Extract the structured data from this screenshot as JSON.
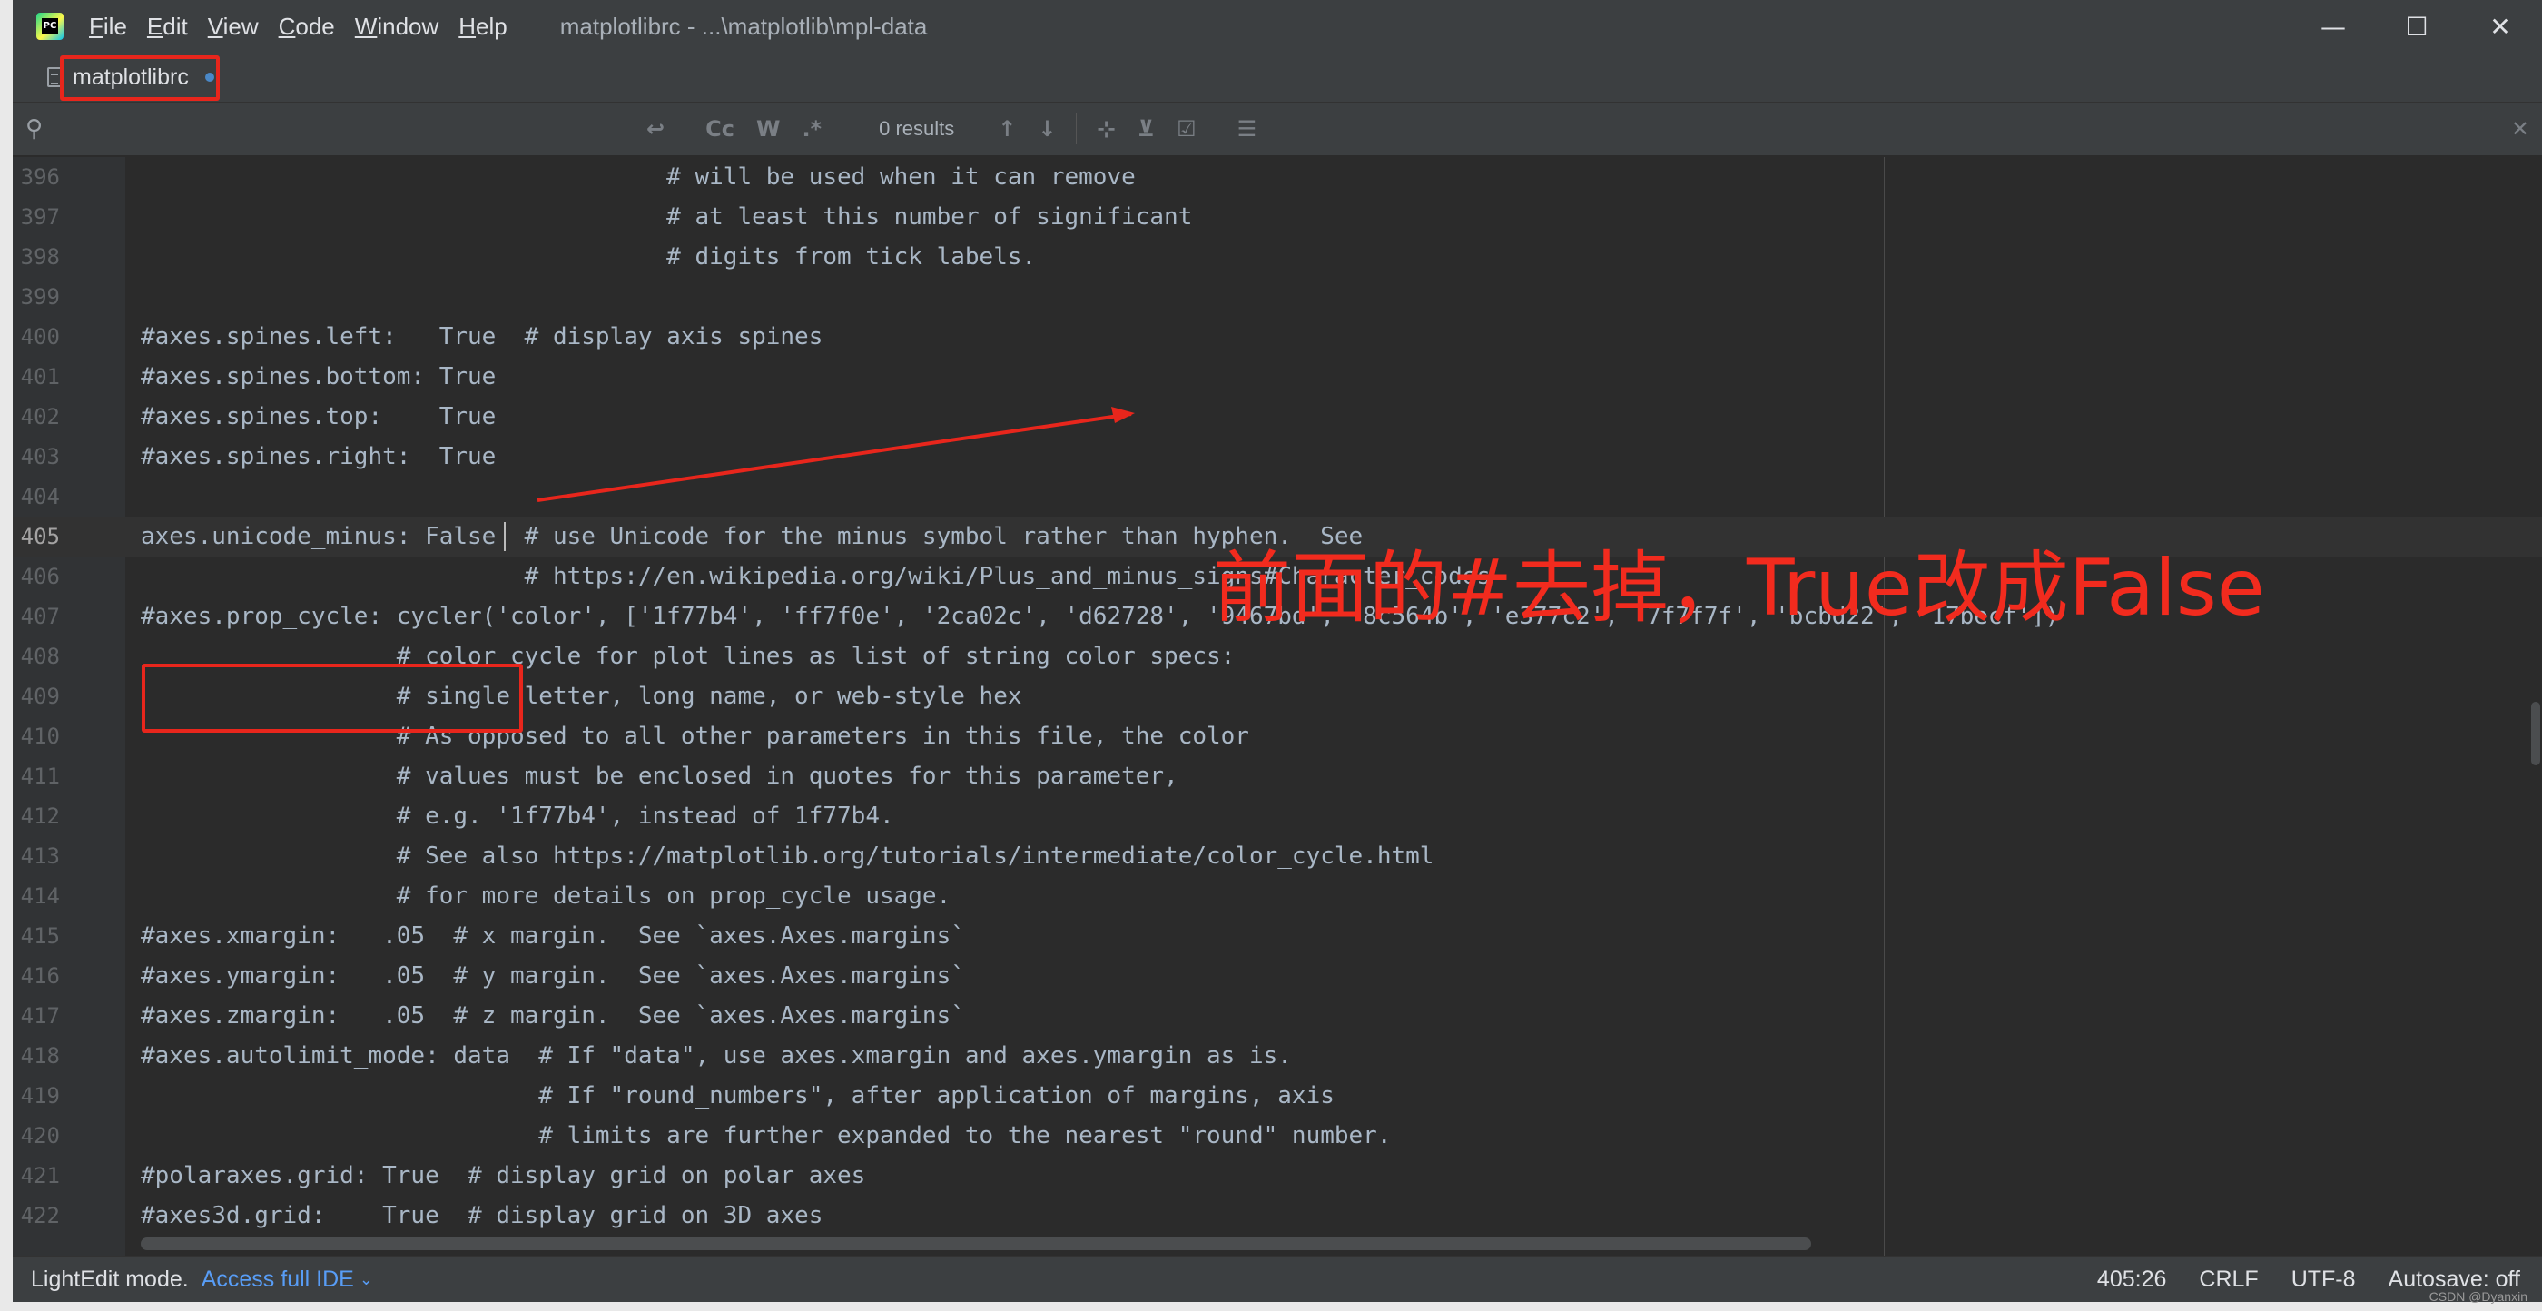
{
  "titlebar": {
    "app_icon": "pycharm-logo-icon",
    "app_icon_text": "PC",
    "menu": [
      {
        "first": "F",
        "rest": "ile"
      },
      {
        "first": "E",
        "rest": "dit"
      },
      {
        "first": "V",
        "rest": "iew"
      },
      {
        "first": "C",
        "rest": "ode"
      },
      {
        "first": "W",
        "rest": "indow"
      },
      {
        "first": "H",
        "rest": "elp"
      }
    ],
    "title": "matplotlibrc - ...\\matplotlib\\mpl-data",
    "controls": {
      "minimize": "—",
      "maximize": "☐",
      "close": "✕"
    }
  },
  "tab": {
    "label": "matplotlibrc",
    "icon": "file-icon",
    "modified_dot_color": "#4a88c7"
  },
  "search": {
    "value": "",
    "placeholder": "",
    "results": "0 results",
    "buttons": {
      "wrap": "↩",
      "match_case": "Cc",
      "words": "W",
      "regex": ".*",
      "prev": "↑",
      "next": "↓",
      "add_occurrence": "⊹",
      "remove_occurrence": "⊻",
      "select_all": "☑",
      "filter": "☰",
      "close": "✕"
    }
  },
  "editor": {
    "current_line": 405,
    "lines": [
      {
        "n": "396",
        "t": "                                     # will be used when it can remove"
      },
      {
        "n": "397",
        "t": "                                     # at least this number of significant"
      },
      {
        "n": "398",
        "t": "                                     # digits from tick labels."
      },
      {
        "n": "399",
        "t": ""
      },
      {
        "n": "400",
        "t": "#axes.spines.left:   True  # display axis spines"
      },
      {
        "n": "401",
        "t": "#axes.spines.bottom: True"
      },
      {
        "n": "402",
        "t": "#axes.spines.top:    True"
      },
      {
        "n": "403",
        "t": "#axes.spines.right:  True"
      },
      {
        "n": "404",
        "t": ""
      },
      {
        "n": "405",
        "t": "axes.unicode_minus: False  # use Unicode for the minus symbol rather than hyphen.  See"
      },
      {
        "n": "406",
        "t": "                           # https://en.wikipedia.org/wiki/Plus_and_minus_signs#Character_codes"
      },
      {
        "n": "407",
        "t": "#axes.prop_cycle: cycler('color', ['1f77b4', 'ff7f0e', '2ca02c', 'd62728', '9467bd', '8c564b', 'e377c2', '7f7f7f', 'bcbd22', '17becf'])"
      },
      {
        "n": "408",
        "t": "                  # color cycle for plot lines as list of string color specs:"
      },
      {
        "n": "409",
        "t": "                  # single letter, long name, or web-style hex"
      },
      {
        "n": "410",
        "t": "                  # As opposed to all other parameters in this file, the color"
      },
      {
        "n": "411",
        "t": "                  # values must be enclosed in quotes for this parameter,"
      },
      {
        "n": "412",
        "t": "                  # e.g. '1f77b4', instead of 1f77b4."
      },
      {
        "n": "413",
        "t": "                  # See also https://matplotlib.org/tutorials/intermediate/color_cycle.html"
      },
      {
        "n": "414",
        "t": "                  # for more details on prop_cycle usage."
      },
      {
        "n": "415",
        "t": "#axes.xmargin:   .05  # x margin.  See `axes.Axes.margins`"
      },
      {
        "n": "416",
        "t": "#axes.ymargin:   .05  # y margin.  See `axes.Axes.margins`"
      },
      {
        "n": "417",
        "t": "#axes.zmargin:   .05  # z margin.  See `axes.Axes.margins`"
      },
      {
        "n": "418",
        "t": "#axes.autolimit_mode: data  # If \"data\", use axes.xmargin and axes.ymargin as is."
      },
      {
        "n": "419",
        "t": "                            # If \"round_numbers\", after application of margins, axis"
      },
      {
        "n": "420",
        "t": "                            # limits are further expanded to the nearest \"round\" number."
      },
      {
        "n": "421",
        "t": "#polaraxes.grid: True  # display grid on polar axes"
      },
      {
        "n": "422",
        "t": "#axes3d.grid:    True  # display grid on 3D axes"
      }
    ]
  },
  "annotation": {
    "text": "前面的#去掉，True改成False",
    "color": "#f22b1e"
  },
  "statusbar": {
    "mode": "LightEdit mode.",
    "access_link": "Access full IDE",
    "access_chevron": "⌄",
    "position": "405:26",
    "line_sep": "CRLF",
    "encoding": "UTF-8",
    "autosave": "Autosave: off"
  },
  "watermark": "CSDN @Dyanxin"
}
